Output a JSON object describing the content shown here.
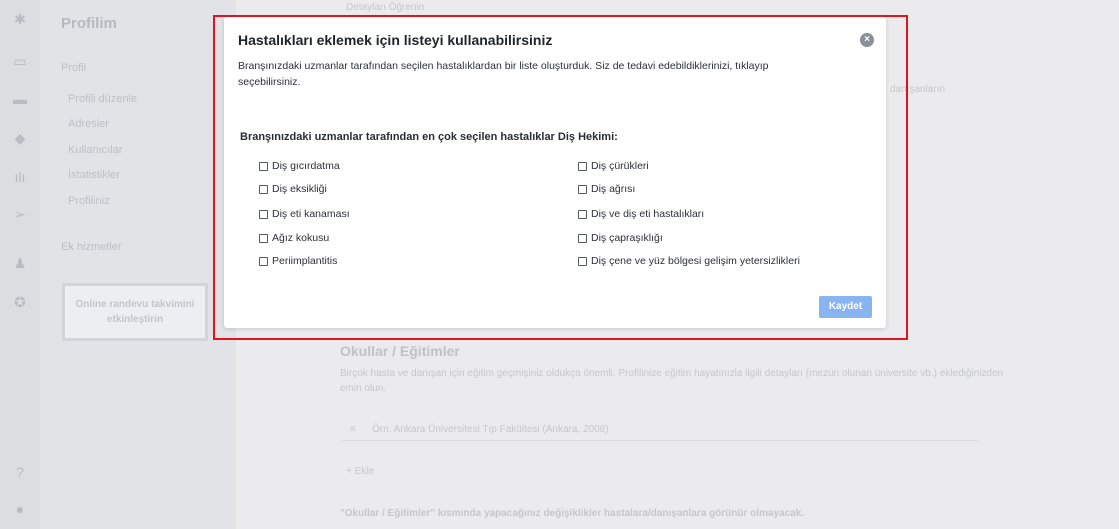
{
  "sidebar": {
    "title": "Profilim",
    "section_profile": "Profil",
    "links": [
      "Profili düzenle",
      "Adresler",
      "Kullanıcılar",
      "İstatistikler",
      "Profiliniz"
    ],
    "section_extra": "Ek hizmetler",
    "cta": "Online randevu takvimini etkinleştirin"
  },
  "background": {
    "top_text": "Detayları Öğrenin",
    "right_snippet": "danışanların",
    "schools_heading": "Okullar / Eğitimler",
    "schools_desc": "Birçok hasta ve danışan için eğitim geçmişiniz oldukça önemli. Profilinize eğitim hayatınızla ilgili detayları (mezun olunan üniversite vb.) eklediğinizden emin olun.",
    "school_value": "Örn. Ankara Üniversitesi Tıp Fakültesi (Ankara, 2008)",
    "add_label": "+ Ekle",
    "footer_note": "\"Okullar / Eğitimler\" kısmında yapacağınız değişiklikler hastalara/danışanlara görünür olmayacak."
  },
  "modal": {
    "title": "Hastalıkları eklemek için listeyi kullanabilirsiniz",
    "description": "Branşınızdaki uzmanlar tarafından seçilen hastalıklardan bir liste oluşturduk. Siz de tedavi edebildiklerinizi, tıklayıp seçebilirsiniz.",
    "list_heading": "Branşınızdaki uzmanlar tarafından en çok seçilen hastalıklar Diş Hekimi:",
    "left_options": [
      "Diş gıcırdatma",
      "Diş eksikliği",
      "Diş eti kanaması",
      "Ağız kokusu",
      "Periimplantitis"
    ],
    "right_options": [
      "Diş çürükleri",
      "Diş ağrısı",
      "Diş ve diş eti hastalıkları",
      "Diş çapraşıklığı",
      "Diş çene ve yüz bölgesi gelişim yetersizlikleri"
    ],
    "save_label": "Kaydet",
    "close_icon": "×"
  },
  "colors": {
    "highlight": "#e0141f",
    "save_button": "#88b5ef"
  }
}
